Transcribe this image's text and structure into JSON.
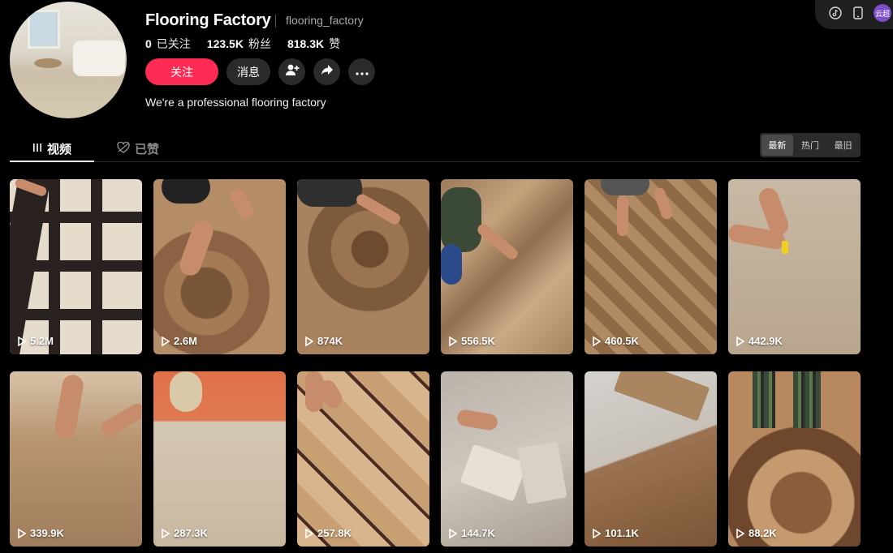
{
  "profile": {
    "name": "Flooring Factory",
    "handle": "flooring_factory",
    "bio": "We're a professional flooring factory",
    "stats": [
      {
        "value": "0",
        "label": "已关注"
      },
      {
        "value": "123.5K",
        "label": "粉丝"
      },
      {
        "value": "818.3K",
        "label": "赞"
      }
    ]
  },
  "actions": {
    "follow_label": "关注",
    "message_label": "消息"
  },
  "top_bar": {
    "avatar_text": "云超"
  },
  "tabs": {
    "videos_label": "视频",
    "liked_label": "已赞"
  },
  "sort": {
    "options": [
      "最新",
      "热门",
      "最旧"
    ],
    "active": "最新"
  },
  "videos": [
    {
      "views": "5.2M"
    },
    {
      "views": "2.6M"
    },
    {
      "views": "874K"
    },
    {
      "views": "556.5K"
    },
    {
      "views": "460.5K"
    },
    {
      "views": "442.9K"
    },
    {
      "views": "339.9K"
    },
    {
      "views": "287.3K"
    },
    {
      "views": "257.8K"
    },
    {
      "views": "144.7K"
    },
    {
      "views": "101.1K"
    },
    {
      "views": "88.2K"
    }
  ],
  "colors": {
    "accent": "#fe2c55",
    "background": "#000000",
    "button_bg": "#2b2b2b"
  }
}
